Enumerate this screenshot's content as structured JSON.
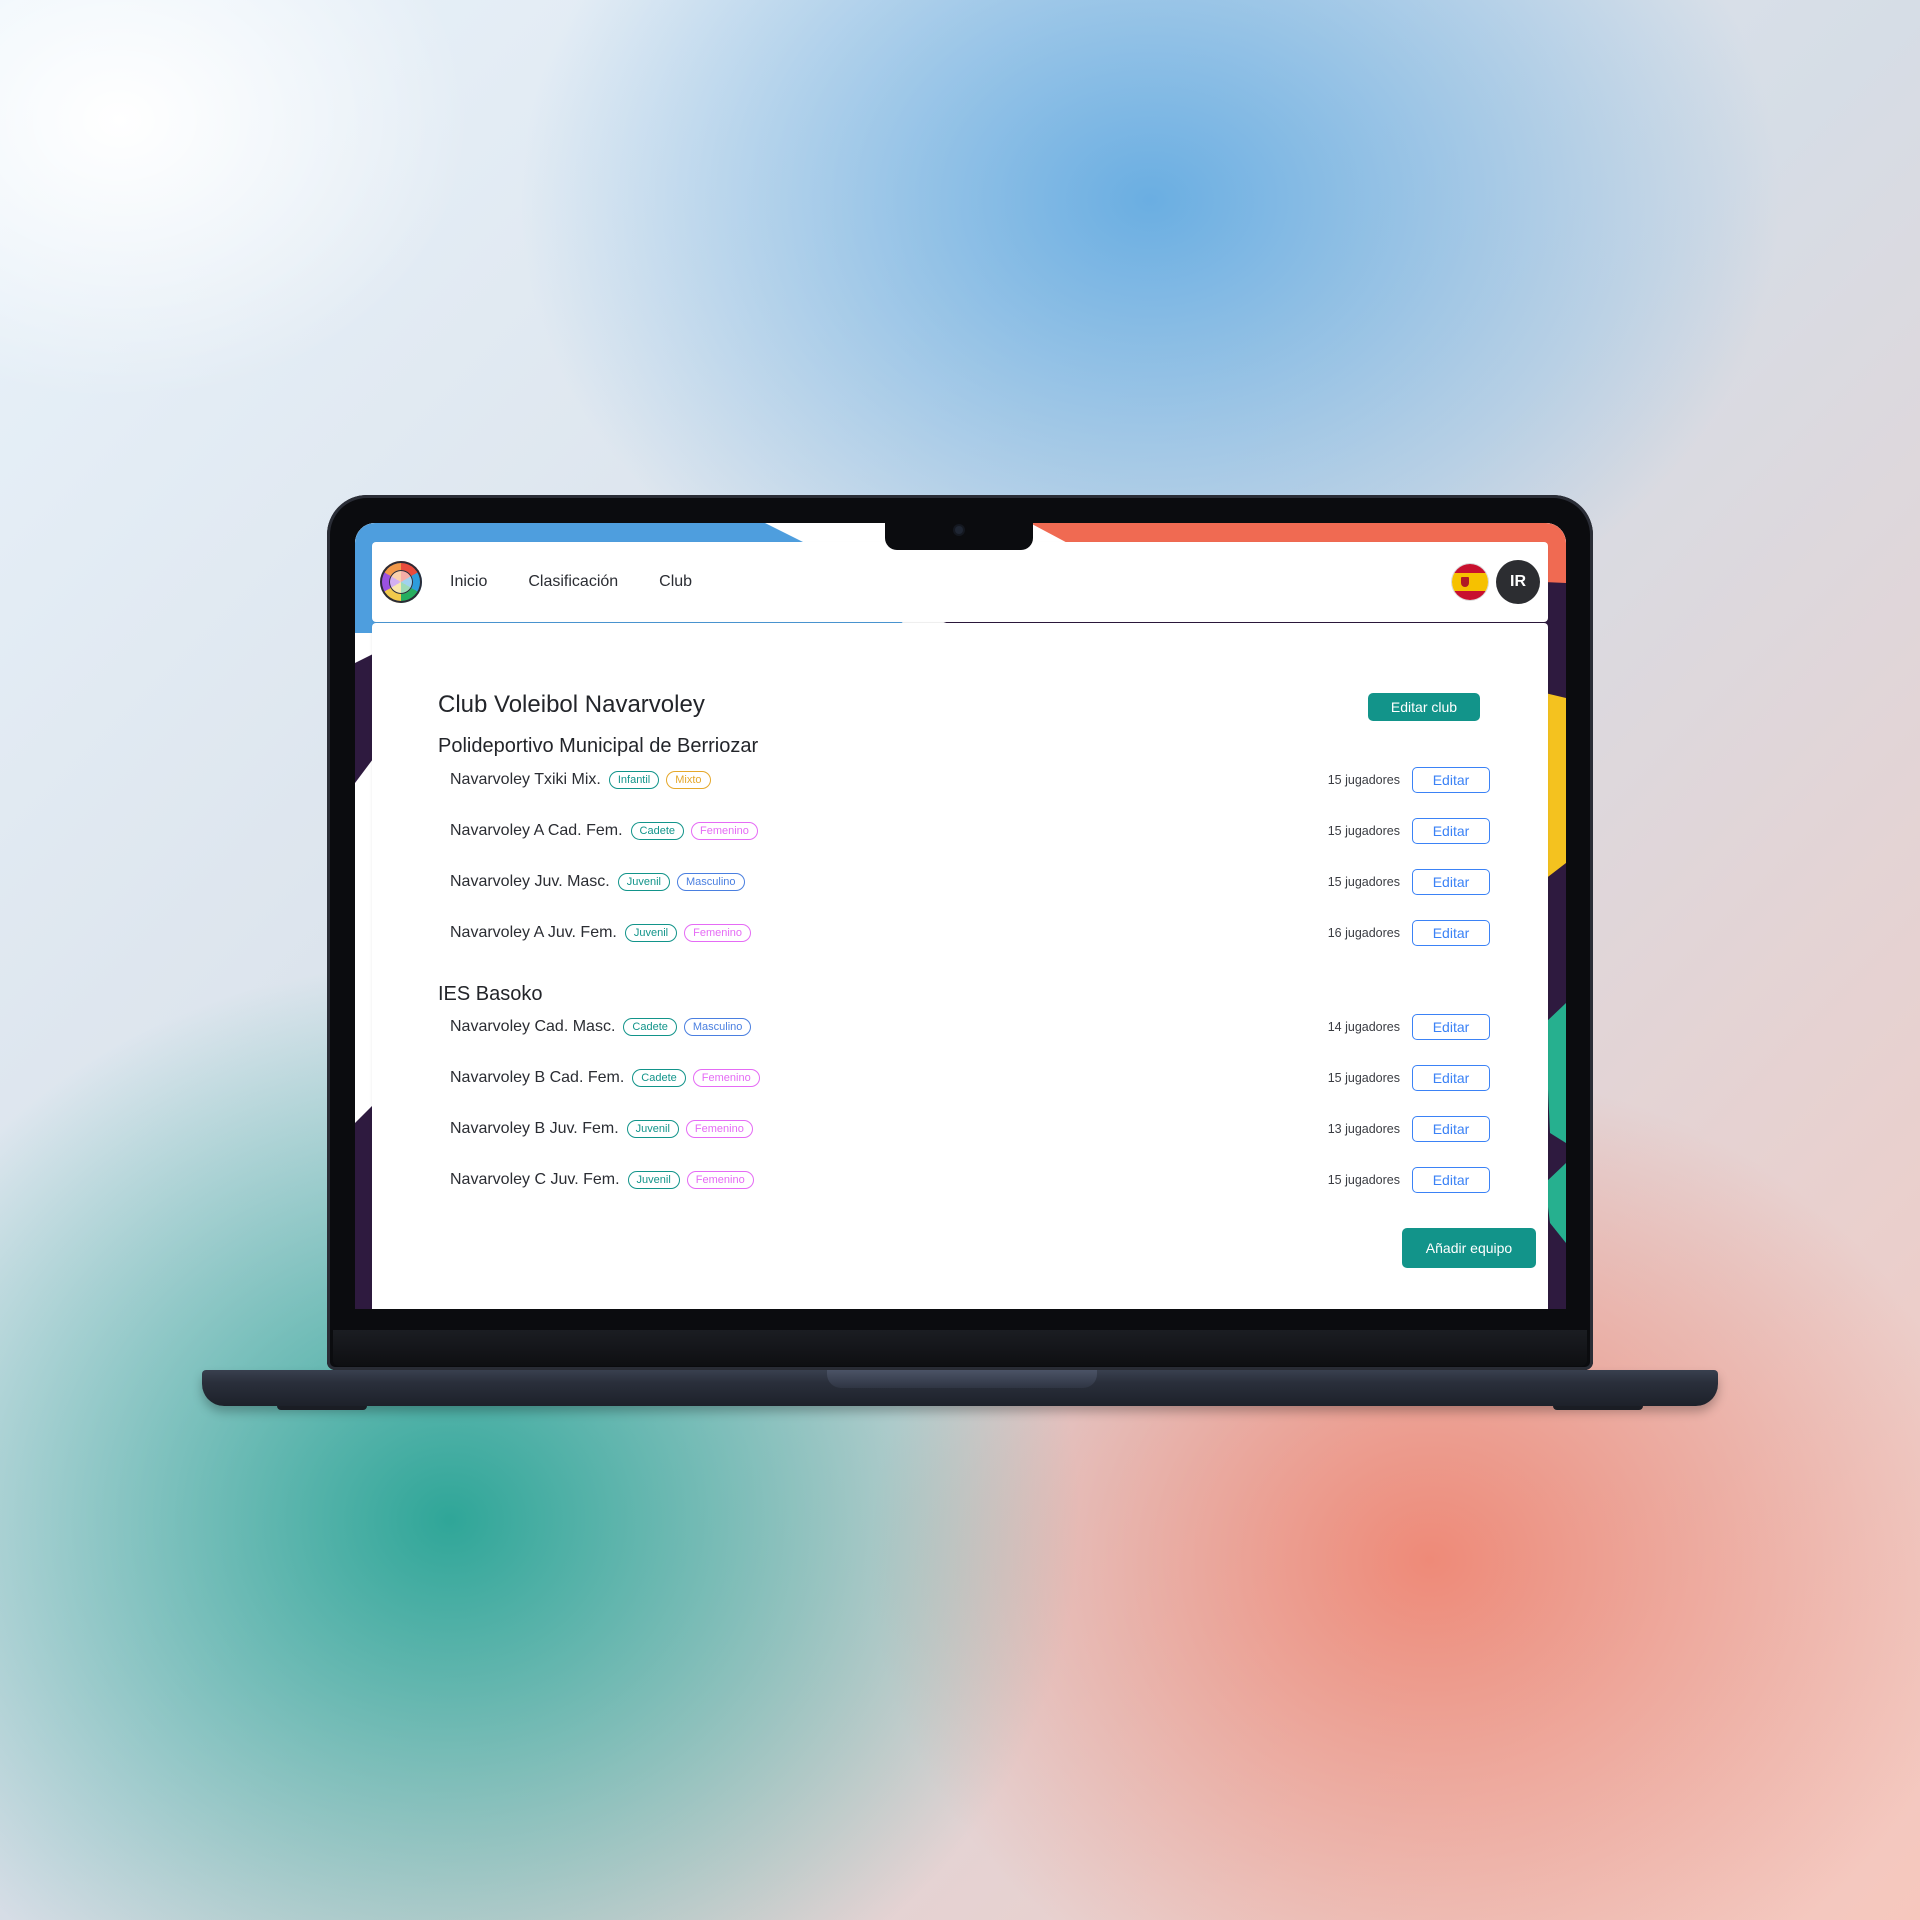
{
  "colors": {
    "primary": "#12948a",
    "edit_outline": "#3b82f6",
    "tag_category": "#12948a",
    "tag_mixto": "#e5a82b",
    "tag_femenino": "#e56bf5",
    "tag_masculino": "#4a7fe0",
    "navbar_bg": "#ffffff",
    "avatar_bg": "#2c2d31"
  },
  "navbar": {
    "logo_icon": "volleyball-logo-icon",
    "links": [
      "Inicio",
      "Clasificación",
      "Club"
    ],
    "language_flag_icon": "spain-flag-icon",
    "avatar_initials": "IR"
  },
  "club": {
    "name": "Club Voleibol Navarvoley",
    "edit_button": "Editar club",
    "add_team_button": "Añadir equipo",
    "venues": [
      {
        "name": "Polideportivo Municipal de Berriozar",
        "teams": [
          {
            "name": "Navarvoley Txiki Mix.",
            "category": "Infantil",
            "gender": "Mixto",
            "players": "15 jugadores",
            "edit": "Editar"
          },
          {
            "name": "Navarvoley A Cad. Fem.",
            "category": "Cadete",
            "gender": "Femenino",
            "players": "15 jugadores",
            "edit": "Editar"
          },
          {
            "name": "Navarvoley Juv. Masc.",
            "category": "Juvenil",
            "gender": "Masculino",
            "players": "15 jugadores",
            "edit": "Editar"
          },
          {
            "name": "Navarvoley A Juv. Fem.",
            "category": "Juvenil",
            "gender": "Femenino",
            "players": "16 jugadores",
            "edit": "Editar"
          }
        ]
      },
      {
        "name": "IES Basoko",
        "teams": [
          {
            "name": "Navarvoley Cad. Masc.",
            "category": "Cadete",
            "gender": "Masculino",
            "players": "14 jugadores",
            "edit": "Editar"
          },
          {
            "name": "Navarvoley B Cad. Fem.",
            "category": "Cadete",
            "gender": "Femenino",
            "players": "15 jugadores",
            "edit": "Editar"
          },
          {
            "name": "Navarvoley B Juv. Fem.",
            "category": "Juvenil",
            "gender": "Femenino",
            "players": "13 jugadores",
            "edit": "Editar"
          },
          {
            "name": "Navarvoley C Juv. Fem.",
            "category": "Juvenil",
            "gender": "Femenino",
            "players": "15 jugadores",
            "edit": "Editar"
          }
        ]
      }
    ]
  }
}
